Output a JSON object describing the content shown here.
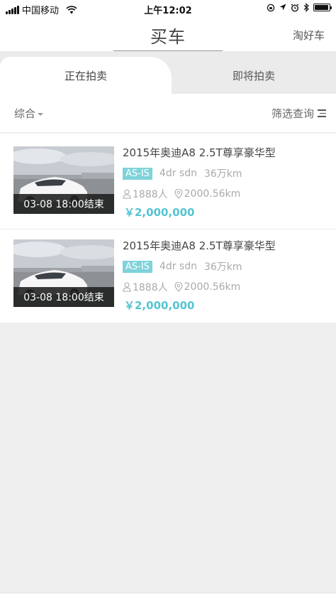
{
  "status_bar": {
    "carrier": "中国移动",
    "time": "上午12:02",
    "battery_level": 0.95
  },
  "navbar": {
    "title": "买车",
    "right_link": "淘好车"
  },
  "tabs": [
    {
      "label": "正在拍卖",
      "active": true
    },
    {
      "label": "即将拍卖",
      "active": false
    }
  ],
  "filter_bar": {
    "sort_label": "综合",
    "query_label": "筛选查询"
  },
  "listings": [
    {
      "end_label": "03-08 18:00结束",
      "title": "2015年奥迪A8 2.5T尊享豪华型",
      "badge": "AS-IS",
      "spec_body": "4dr sdn",
      "spec_mileage": "36万km",
      "bidders": "1888人",
      "distance": "2000.56km",
      "price": "￥2,000,000"
    },
    {
      "end_label": "03-08 18:00结束",
      "title": "2015年奥迪A8 2.5T尊享豪华型",
      "badge": "AS-IS",
      "spec_body": "4dr sdn",
      "spec_mileage": "36万km",
      "bidders": "1888人",
      "distance": "2000.56km",
      "price": "￥2,000,000"
    }
  ],
  "colors": {
    "accent": "#55c4d1",
    "badge_bg": "#7ed3da"
  }
}
